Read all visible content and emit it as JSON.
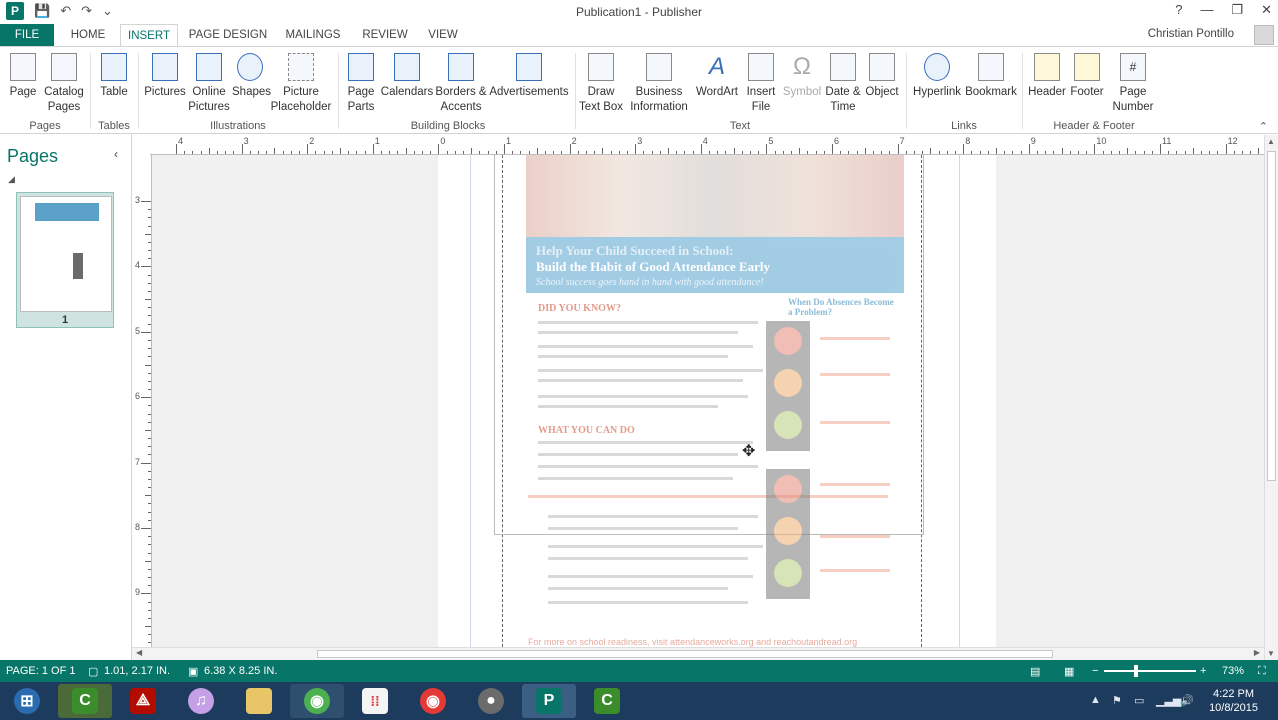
{
  "window": {
    "title": "Publication1 - Publisher",
    "user": "Christian Pontillo",
    "controls": [
      "?",
      "—",
      "❐",
      "✕"
    ]
  },
  "qat": [
    "save-icon",
    "undo-icon",
    "redo-icon",
    "customize-icon"
  ],
  "tabs": [
    "FILE",
    "HOME",
    "INSERT",
    "PAGE DESIGN",
    "MAILINGS",
    "REVIEW",
    "VIEW"
  ],
  "active_tab": "INSERT",
  "ribbon": {
    "groups": [
      "Pages",
      "Tables",
      "Illustrations",
      "Building Blocks",
      "Text",
      "Links",
      "Header & Footer"
    ],
    "buttons": {
      "page": {
        "l1": "Page",
        "l2": ""
      },
      "catalog": {
        "l1": "Catalog",
        "l2": "Pages"
      },
      "table": {
        "l1": "Table",
        "l2": ""
      },
      "pictures": {
        "l1": "Pictures",
        "l2": ""
      },
      "online_pictures": {
        "l1": "Online",
        "l2": "Pictures"
      },
      "shapes": {
        "l1": "Shapes",
        "l2": ""
      },
      "picture_placeholder": {
        "l1": "Picture",
        "l2": "Placeholder"
      },
      "page_parts": {
        "l1": "Page",
        "l2": "Parts"
      },
      "calendars": {
        "l1": "Calendars",
        "l2": ""
      },
      "borders": {
        "l1": "Borders &",
        "l2": "Accents"
      },
      "advertisements": {
        "l1": "Advertisements",
        "l2": ""
      },
      "draw_text_box": {
        "l1": "Draw",
        "l2": "Text Box"
      },
      "business_info": {
        "l1": "Business",
        "l2": "Information"
      },
      "wordart": {
        "l1": "WordArt",
        "l2": ""
      },
      "insert_file": {
        "l1": "Insert",
        "l2": "File"
      },
      "symbol": {
        "l1": "Symbol",
        "l2": ""
      },
      "date_time": {
        "l1": "Date &",
        "l2": "Time"
      },
      "object": {
        "l1": "Object",
        "l2": ""
      },
      "hyperlink": {
        "l1": "Hyperlink",
        "l2": ""
      },
      "bookmark": {
        "l1": "Bookmark",
        "l2": ""
      },
      "header": {
        "l1": "Header",
        "l2": ""
      },
      "footer": {
        "l1": "Footer",
        "l2": ""
      },
      "page_number": {
        "l1": "Page",
        "l2": "Number"
      }
    }
  },
  "pages_panel": {
    "title": "Pages",
    "thumb_number": "1"
  },
  "hruler_labels": [
    "4",
    "3",
    "2",
    "1",
    "0",
    "1",
    "2",
    "3",
    "4",
    "5",
    "6",
    "7",
    "8",
    "9",
    "10",
    "11",
    "12"
  ],
  "vruler_labels": [
    "3",
    "4",
    "5",
    "6",
    "7",
    "8",
    "9"
  ],
  "document": {
    "heading1": "Help Your Child Succeed in School:",
    "heading2": "Build the Habit of Good Attendance Early",
    "sub": "School success goes hand in hand with good attendance!",
    "did_you_know": "DID YOU KNOW?",
    "what_you_can_do": "WHAT YOU CAN DO",
    "when_absences": "When Do Absences Become a Problem?",
    "footer_note": "For more on school readiness, visit attendanceworks.org and reachoutandread.org"
  },
  "statusbar": {
    "page": "PAGE: 1 OF 1",
    "position": "1.01, 2.17 IN.",
    "size": "6.38 X 8.25 IN.",
    "zoom": "73%"
  },
  "taskbar": {
    "clock_time": "4:22 PM",
    "clock_date": "10/8/2015"
  }
}
